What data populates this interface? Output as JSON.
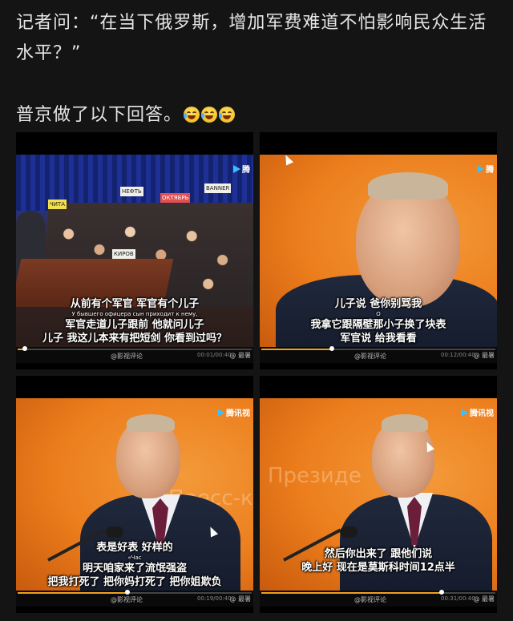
{
  "post": {
    "question": "记者问：“在当下俄罗斯，增加军费难道不怕影响民众生活水平？”",
    "answer": "普京做了以下回答。",
    "emoji_count": 3,
    "emoji_icon": "crying-laughing-face-icon"
  },
  "tiles": [
    {
      "logo": "腾",
      "subtitles": [
        "从前有个军官 军官有个儿子",
        "У бывшего офицера сын приходит к нему,",
        "军官走道儿子跟前 他就问儿子",
        "儿子 我这儿本来有把短剑 你看到过吗？"
      ],
      "watermark": "@影视评论",
      "time": "00:01/00:40",
      "watermark2": "@ 最暑",
      "progress": 0.03
    },
    {
      "logo": "腾",
      "subtitles": [
        "儿子说 爸你别骂我",
        "О",
        "我拿它跟隔壁那小子换了块表",
        "军官说 给我看看"
      ],
      "watermark": "@影视评论",
      "time": "00:12/00:40",
      "watermark2": "@ 最暑",
      "progress": 0.3
    },
    {
      "logo": "腾讯视",
      "background_text": "Пресс-конференция",
      "subtitles": [
        "表是好表 好样的",
        "«Час",
        "明天咱家来了流氓强盗",
        "把我打死了 把你妈打死了 把你姐欺负"
      ],
      "watermark": "@影视评论",
      "time": "00:19/00:40",
      "watermark2": "@ 最暑",
      "progress": 0.47
    },
    {
      "logo": "腾讯视",
      "background_text": "Президе",
      "subtitles": [
        "然后你出来了 跟他们说",
        "晚上好 现在是莫斯科时间12点半"
      ],
      "watermark": "@影视评论",
      "time": "00:31/00:40",
      "watermark2": "@ 最暑",
      "progress": 0.77
    }
  ]
}
